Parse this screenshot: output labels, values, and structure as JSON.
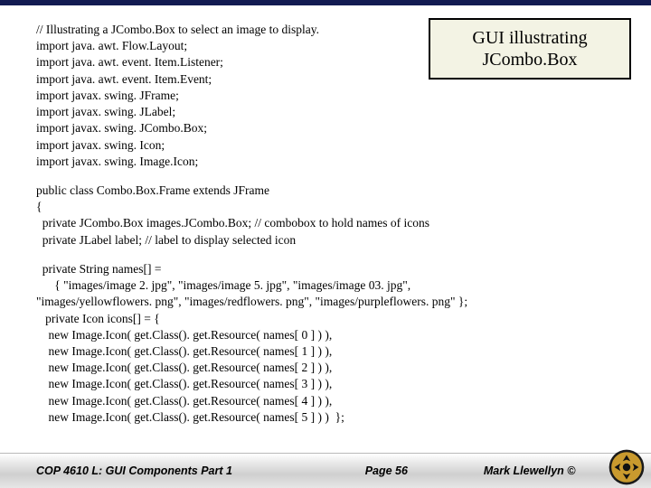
{
  "title": {
    "line1": "GUI illustrating",
    "line2": "JCombo.Box"
  },
  "code": {
    "imports": "// Illustrating a JCombo.Box to select an image to display.\nimport java. awt. Flow.Layout;\nimport java. awt. event. Item.Listener;\nimport java. awt. event. Item.Event;\nimport javax. swing. JFrame;\nimport javax. swing. JLabel;\nimport javax. swing. JCombo.Box;\nimport javax. swing. Icon;\nimport javax. swing. Image.Icon;",
    "classdecl": "public class Combo.Box.Frame extends JFrame\n{\n  private JCombo.Box images.JCombo.Box; // combobox to hold names of icons\n  private JLabel label; // label to display selected icon",
    "fields": "  private String names[] =\n      { \"images/image 2. jpg\", \"images/image 5. jpg\", \"images/image 03. jpg\",\n\"images/yellowflowers. png\", \"images/redflowers. png\", \"images/purpleflowers. png\" };\n   private Icon icons[] = {\n    new Image.Icon( get.Class(). get.Resource( names[ 0 ] ) ),\n    new Image.Icon( get.Class(). get.Resource( names[ 1 ] ) ),\n    new Image.Icon( get.Class(). get.Resource( names[ 2 ] ) ),\n    new Image.Icon( get.Class(). get.Resource( names[ 3 ] ) ),\n    new Image.Icon( get.Class(). get.Resource( names[ 4 ] ) ),\n    new Image.Icon( get.Class(). get.Resource( names[ 5 ] ) )  };"
  },
  "footer": {
    "left": "COP 4610 L: GUI Components Part 1",
    "center": "Page 56",
    "right": "Mark Llewellyn ©"
  }
}
